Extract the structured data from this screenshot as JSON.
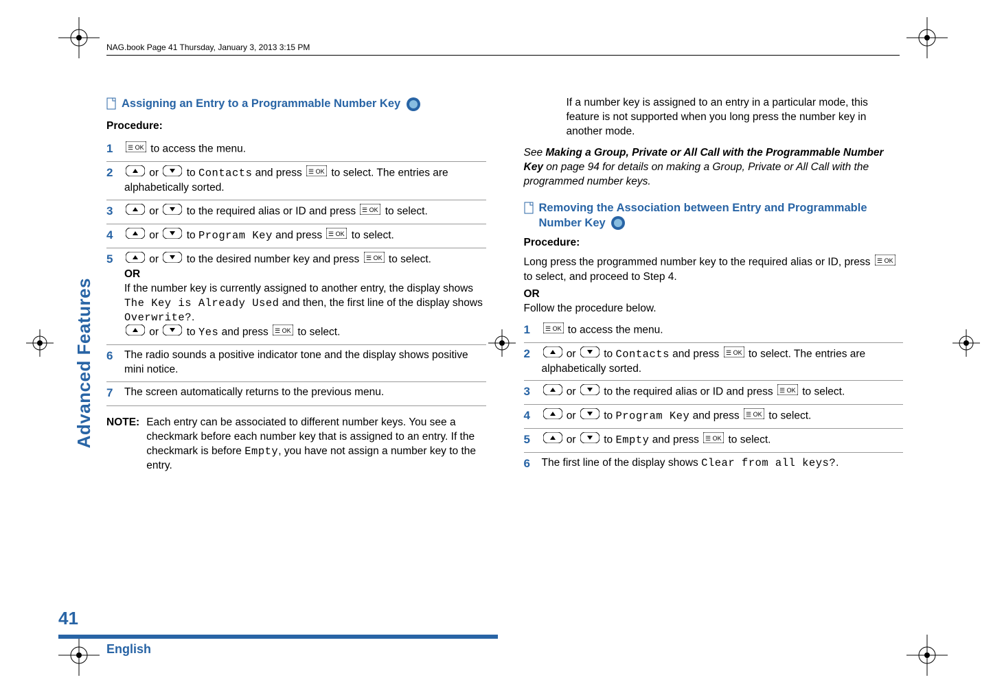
{
  "header": {
    "bookline": "NAG.book  Page 41  Thursday, January 3, 2013  3:15 PM"
  },
  "sidebar": {
    "text": "Advanced Features"
  },
  "page_number": "41",
  "footer": {
    "language": "English"
  },
  "left": {
    "heading": "Assigning an Entry to a Programmable Number Key",
    "procedure_label": "Procedure:",
    "steps": {
      "s1": {
        "text_after": " to access the menu."
      },
      "s2": {
        "mid1": " or ",
        "mid2": " to ",
        "contacts": "Contacts",
        "mid3": " and press ",
        "tail": " to select. The entries are alphabetically sorted."
      },
      "s3": {
        "mid1": " or ",
        "mid2": " to the required alias or ID and press ",
        "tail": " to select."
      },
      "s4": {
        "mid1": " or ",
        "mid2": " to ",
        "program_key": "Program Key",
        "mid3": " and press ",
        "tail": " to select."
      },
      "s5": {
        "mid1": " or ",
        "mid2": " to the desired number key and press ",
        "tail": " to select.",
        "or": "OR",
        "line2a": "If the number key is currently assigned to another entry, the display shows ",
        "lcd1": "The Key is Already Used",
        "line2b": " and then, the first line of the display shows ",
        "lcd2": "Overwrite?",
        "dot": ".",
        "line3_mid1": " or ",
        "line3_mid2": " to ",
        "yes": "Yes",
        "line3_mid3": " and press ",
        "line3_tail": " to select."
      },
      "s6": {
        "text": "The radio sounds a positive indicator tone and the display shows positive mini notice."
      },
      "s7": {
        "text": "The screen automatically returns to the previous menu."
      }
    },
    "note": {
      "label": "NOTE:",
      "body_a": "Each entry can be associated to different number keys. You see a checkmark before each number key that is assigned to an entry. If the checkmark is before ",
      "empty": "Empty",
      "body_b": ", you have not assign a number key to the entry."
    }
  },
  "right": {
    "top_indent": "If a number key is assigned to an entry in a particular mode, this feature is not supported when you long press the number key in another mode.",
    "see_line_a": "See ",
    "see_bold": "Making a Group, Private or All Call with the Programmable Number Key",
    "see_line_b": " on page 94 for details on making a Group, Private or All Call with the programmed number keys.",
    "heading": "Removing the Association between Entry and Programmable Number Key",
    "procedure_label": "Procedure:",
    "intro_a": "Long press the programmed number key to the required alias or ID, press ",
    "intro_b": " to select, and proceed to Step 4.",
    "or": "OR",
    "intro_c": "Follow the procedure below.",
    "steps": {
      "s1": {
        "text_after": " to access the menu."
      },
      "s2": {
        "mid1": " or ",
        "mid2": " to ",
        "contacts": "Contacts",
        "mid3": " and press ",
        "tail": " to select. The entries are alphabetically sorted."
      },
      "s3": {
        "mid1": " or ",
        "mid2": " to the required alias or ID and press ",
        "tail": " to select."
      },
      "s4": {
        "mid1": " or ",
        "mid2": " to ",
        "program_key": "Program Key",
        "mid3": " and press ",
        "tail": " to select."
      },
      "s5": {
        "mid1": " or ",
        "mid2": " to ",
        "empty": "Empty",
        "mid3": " and press ",
        "tail": " to select."
      },
      "s6": {
        "text_a": "The first line of the display shows ",
        "lcd": "Clear from all keys?",
        "dot": "."
      }
    }
  }
}
